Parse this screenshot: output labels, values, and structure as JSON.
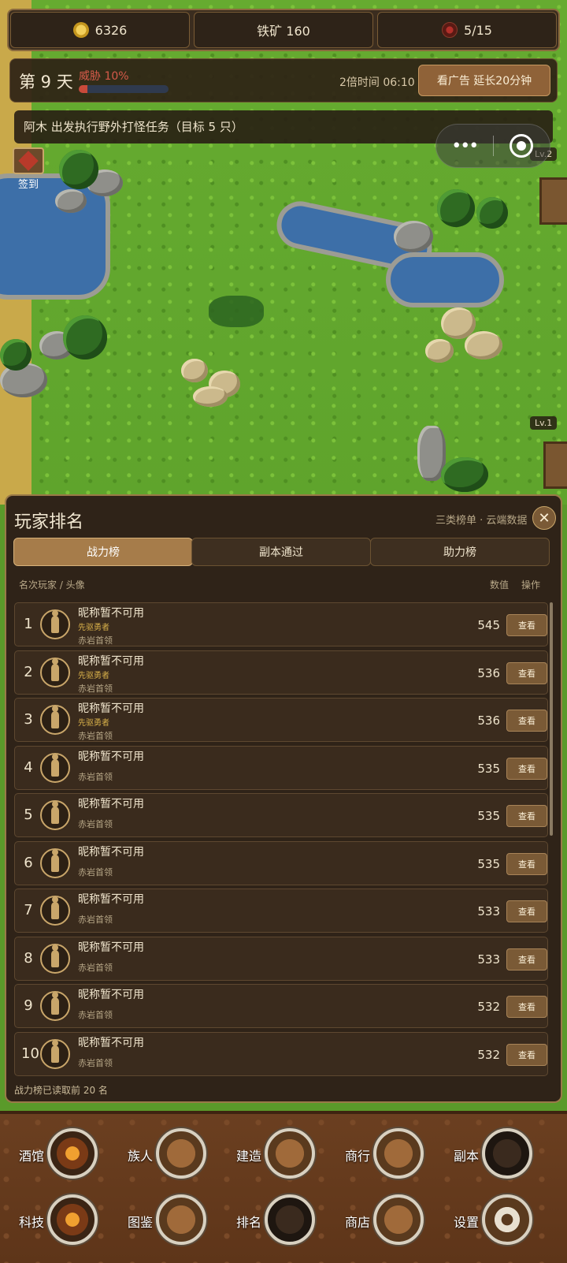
{
  "resources": {
    "gold": "6326",
    "iron": "铁矿 160",
    "population": "5/15"
  },
  "daybar": {
    "day": "第 9 天",
    "threat": "威胁 10%",
    "threat_level": 0.1,
    "speed": "2倍时间 06:10",
    "ad_button": "看广告 延长20分钟"
  },
  "mission": "阿木 出发执行野外打怪任务（目标 5 只）",
  "capsule": {
    "menu": "•••"
  },
  "checkin": "签到",
  "map_labels": {
    "lv2": "Lv.2",
    "lv1": "Lv.1"
  },
  "panel": {
    "title": "玩家排名",
    "subtitle": "三类榜单 · 云端数据",
    "close": "✕",
    "tabs": [
      "战力榜",
      "副本通过",
      "助力榜"
    ],
    "header": {
      "left": "名次玩家 / 头像",
      "value": "数值",
      "action": "操作"
    },
    "footer": "战力榜已读取前 20 名",
    "view_label": "查看"
  },
  "rankings": [
    {
      "rank": "1",
      "name": "昵称暂不可用",
      "title": "先驱勇者",
      "clan": "赤岩首领",
      "score": "545"
    },
    {
      "rank": "2",
      "name": "昵称暂不可用",
      "title": "先驱勇者",
      "clan": "赤岩首领",
      "score": "536"
    },
    {
      "rank": "3",
      "name": "昵称暂不可用",
      "title": "先驱勇者",
      "clan": "赤岩首领",
      "score": "536"
    },
    {
      "rank": "4",
      "name": "昵称暂不可用",
      "title": "",
      "clan": "赤岩首领",
      "score": "535"
    },
    {
      "rank": "5",
      "name": "昵称暂不可用",
      "title": "",
      "clan": "赤岩首领",
      "score": "535"
    },
    {
      "rank": "6",
      "name": "昵称暂不可用",
      "title": "",
      "clan": "赤岩首领",
      "score": "535"
    },
    {
      "rank": "7",
      "name": "昵称暂不可用",
      "title": "",
      "clan": "赤岩首领",
      "score": "533"
    },
    {
      "rank": "8",
      "name": "昵称暂不可用",
      "title": "",
      "clan": "赤岩首领",
      "score": "533"
    },
    {
      "rank": "9",
      "name": "昵称暂不可用",
      "title": "",
      "clan": "赤岩首领",
      "score": "532"
    },
    {
      "rank": "10",
      "name": "昵称暂不可用",
      "title": "",
      "clan": "赤岩首领",
      "score": "532"
    }
  ],
  "nav": [
    {
      "label": "酒馆",
      "icon": "tavern-icon"
    },
    {
      "label": "族人",
      "icon": "tribesmen-icon"
    },
    {
      "label": "建造",
      "icon": "build-icon"
    },
    {
      "label": "商行",
      "icon": "trading-house-icon"
    },
    {
      "label": "副本",
      "icon": "dungeon-icon"
    },
    {
      "label": "科技",
      "icon": "tech-icon"
    },
    {
      "label": "图鉴",
      "icon": "codex-icon"
    },
    {
      "label": "排名",
      "icon": "ranking-icon"
    },
    {
      "label": "商店",
      "icon": "shop-icon"
    },
    {
      "label": "设置",
      "icon": "settings-icon"
    }
  ]
}
